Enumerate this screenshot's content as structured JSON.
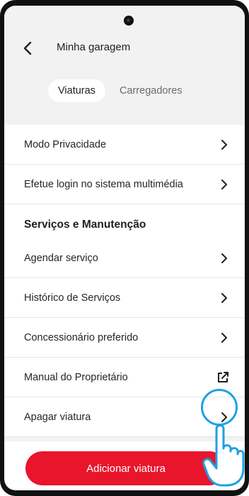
{
  "header": {
    "title": "Minha garagem"
  },
  "tabs": [
    {
      "label": "Viaturas",
      "active": true
    },
    {
      "label": "Carregadores",
      "active": false
    }
  ],
  "list": {
    "top_items": [
      {
        "label": "Modo Privacidade",
        "icon": "chevron-right-icon"
      },
      {
        "label": "Efetue login no sistema multimédia",
        "icon": "chevron-right-icon"
      }
    ],
    "section_title": "Serviços e Manutenção",
    "section_items": [
      {
        "label": "Agendar serviço",
        "icon": "chevron-right-icon"
      },
      {
        "label": "Histórico de Serviços",
        "icon": "chevron-right-icon"
      },
      {
        "label": "Concessionário preferido",
        "icon": "chevron-right-icon"
      },
      {
        "label": "Manual do Proprietário",
        "icon": "external-link-icon"
      },
      {
        "label": "Apagar viatura",
        "icon": "chevron-right-icon"
      }
    ]
  },
  "cta": {
    "label": "Adicionar viatura",
    "color": "#e8152b"
  },
  "colors": {
    "accent": "#e8152b",
    "highlight": "#1da1e6",
    "header_bg": "#f2f2f2"
  }
}
